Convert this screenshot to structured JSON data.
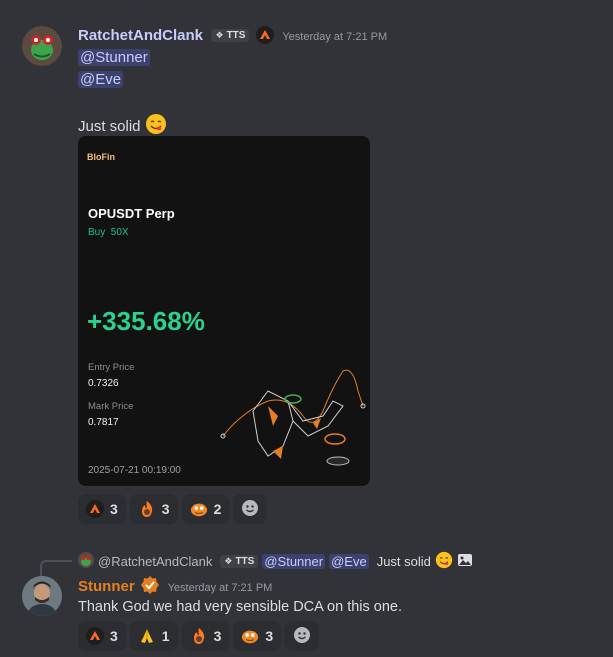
{
  "colors": {
    "accent_username": "#c9cdfb",
    "stunner_name": "#e67e22",
    "pnl_green": "#2bd18f"
  },
  "message1": {
    "author": "RatchetAndClank",
    "tag": "TTS",
    "timestamp": "Yesterday at 7:21 PM",
    "mentions": [
      "@Stunner",
      "@Eve"
    ],
    "text": "Just solid",
    "card": {
      "brand": "BloFin",
      "pair": "OPUSDT Perp",
      "side": "Buy",
      "leverage": "50X",
      "pnl": "+335.68%",
      "entry_label": "Entry Price",
      "entry_value": "0.7326",
      "mark_label": "Mark Price",
      "mark_value": "0.7817",
      "datetime": "2025-07-21 00:19:00"
    },
    "reactions": [
      {
        "emoji": "orange-fire-logo",
        "count": "3"
      },
      {
        "emoji": "pepe-flame",
        "count": "3"
      },
      {
        "emoji": "orange-creature",
        "count": "2"
      }
    ]
  },
  "message2": {
    "reply": {
      "author": "@RatchetAndClank",
      "tag": "TTS",
      "mentions": [
        "@Stunner",
        "@Eve"
      ],
      "text": "Just solid"
    },
    "author": "Stunner",
    "timestamp": "Yesterday at 7:21 PM",
    "text": "Thank God we had very sensible DCA on this one.",
    "reactions": [
      {
        "emoji": "orange-fire-logo",
        "count": "3"
      },
      {
        "emoji": "praying-hands",
        "count": "1"
      },
      {
        "emoji": "pepe-flame",
        "count": "3"
      },
      {
        "emoji": "orange-creature",
        "count": "3"
      }
    ]
  }
}
